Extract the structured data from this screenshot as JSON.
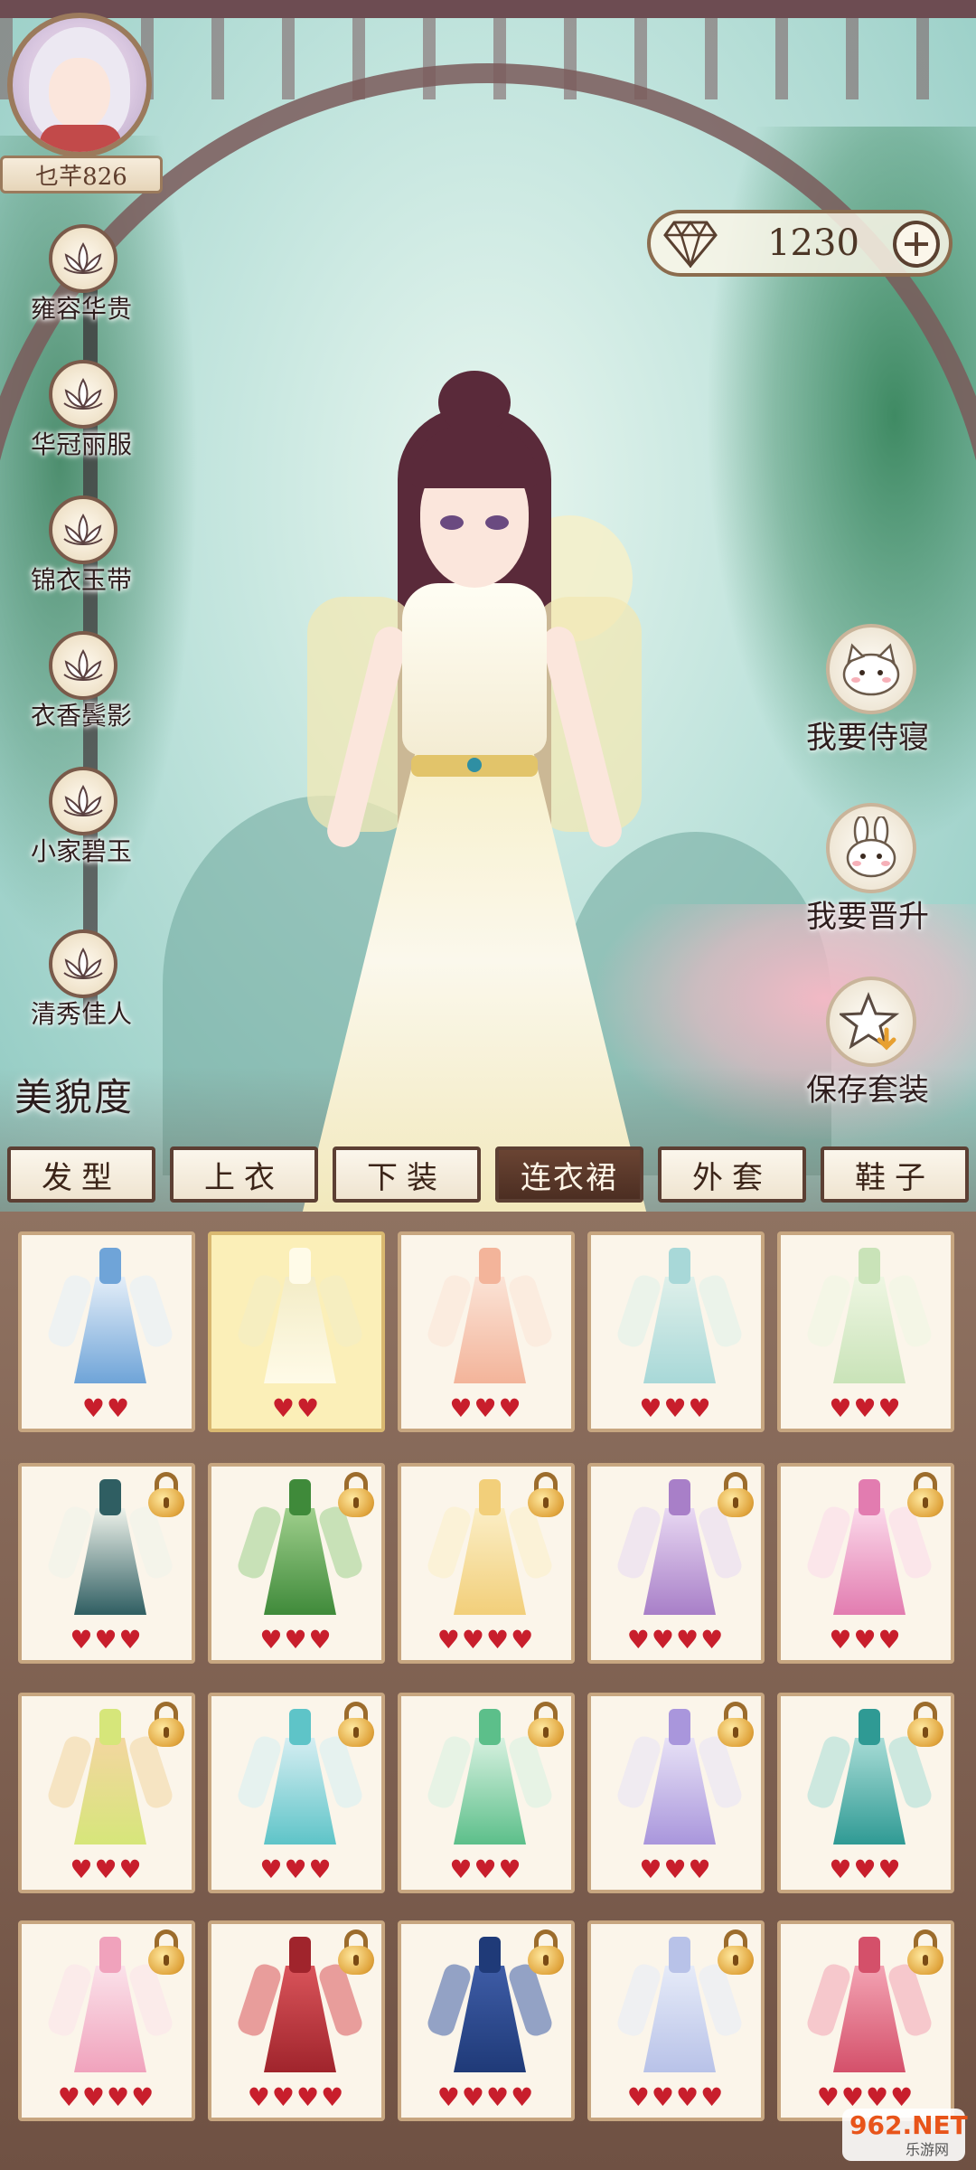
{
  "player": {
    "name": "乜芊826"
  },
  "currency": {
    "diamonds": "1230",
    "icon": "diamond-icon",
    "add_icon": "plus-icon"
  },
  "styles": [
    {
      "label": "雍容华贵",
      "icon": "lotus-icon"
    },
    {
      "label": "华冠丽服",
      "icon": "lotus-icon"
    },
    {
      "label": "锦衣玉带",
      "icon": "lotus-icon"
    },
    {
      "label": "衣香鬓影",
      "icon": "lotus-icon"
    },
    {
      "label": "小家碧玉",
      "icon": "lotus-icon"
    },
    {
      "label": "清秀佳人",
      "icon": "lotus-icon"
    }
  ],
  "beauty_label": "美貌度",
  "actions": [
    {
      "label": "我要侍寝",
      "icon": "cat-icon"
    },
    {
      "label": "我要晋升",
      "icon": "rabbit-icon"
    },
    {
      "label": "保存套装",
      "icon": "star-save-icon"
    }
  ],
  "tabs": [
    {
      "label": "发型",
      "active": false
    },
    {
      "label": "上衣",
      "active": false
    },
    {
      "label": "下装",
      "active": false
    },
    {
      "label": "连衣裙",
      "active": true
    },
    {
      "label": "外套",
      "active": false
    },
    {
      "label": "鞋子",
      "active": false
    }
  ],
  "items": [
    {
      "hearts": 2,
      "locked": false,
      "selected": false,
      "colors": [
        "#6fa4d8",
        "#e4eef8"
      ]
    },
    {
      "hearts": 2,
      "locked": false,
      "selected": true,
      "colors": [
        "#fffbe8",
        "#f3ecc6"
      ]
    },
    {
      "hearts": 3,
      "locked": false,
      "selected": false,
      "colors": [
        "#f3b49a",
        "#fbe3d6"
      ]
    },
    {
      "hearts": 3,
      "locked": false,
      "selected": false,
      "colors": [
        "#a8d8d8",
        "#dff0ea"
      ]
    },
    {
      "hearts": 3,
      "locked": false,
      "selected": false,
      "colors": [
        "#c9e3b8",
        "#eef6e2"
      ]
    },
    {
      "hearts": 3,
      "locked": true,
      "selected": false,
      "colors": [
        "#2f5e62",
        "#eef2ea"
      ]
    },
    {
      "hearts": 3,
      "locked": true,
      "selected": false,
      "colors": [
        "#3f8a3a",
        "#9fcf8c"
      ]
    },
    {
      "hearts": 4,
      "locked": true,
      "selected": false,
      "colors": [
        "#f2cf7a",
        "#fbeec6"
      ]
    },
    {
      "hearts": 4,
      "locked": true,
      "selected": false,
      "colors": [
        "#a87fc8",
        "#e8d8f2"
      ]
    },
    {
      "hearts": 3,
      "locked": true,
      "selected": false,
      "colors": [
        "#e27cb0",
        "#fbd9ea"
      ]
    },
    {
      "hearts": 3,
      "locked": true,
      "selected": false,
      "colors": [
        "#d6e67a",
        "#f3d6a0"
      ]
    },
    {
      "hearts": 3,
      "locked": true,
      "selected": false,
      "colors": [
        "#5ec4c8",
        "#d6eef2"
      ]
    },
    {
      "hearts": 3,
      "locked": true,
      "selected": false,
      "colors": [
        "#5cbf8a",
        "#d7f1e0"
      ]
    },
    {
      "hearts": 3,
      "locked": true,
      "selected": false,
      "colors": [
        "#a996dc",
        "#e8e2f6"
      ]
    },
    {
      "hearts": 3,
      "locked": true,
      "selected": false,
      "colors": [
        "#2f9a94",
        "#a8dcd6"
      ]
    },
    {
      "hearts": 4,
      "locked": true,
      "selected": false,
      "colors": [
        "#f0a2bc",
        "#fbe2ea"
      ]
    },
    {
      "hearts": 4,
      "locked": true,
      "selected": false,
      "colors": [
        "#a0242c",
        "#d9545a"
      ]
    },
    {
      "hearts": 4,
      "locked": true,
      "selected": false,
      "colors": [
        "#1f3a78",
        "#3e5ca6"
      ]
    },
    {
      "hearts": 4,
      "locked": true,
      "selected": false,
      "colors": [
        "#b8c2e8",
        "#e6ebf8"
      ]
    },
    {
      "hearts": 4,
      "locked": true,
      "selected": false,
      "colors": [
        "#d4506a",
        "#f3a3b3"
      ]
    }
  ],
  "watermark": {
    "main": "962.NET",
    "sub": "乐游网"
  }
}
